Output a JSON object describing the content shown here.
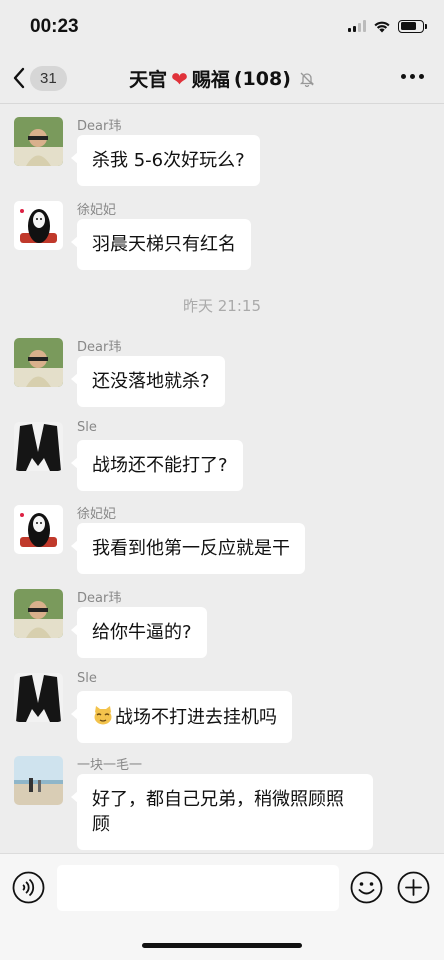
{
  "status_bar": {
    "time": "00:23",
    "battery_level": 0.75
  },
  "nav": {
    "back_count": "31",
    "title_left": "天官",
    "title_right": "赐福",
    "member_count": "(108)"
  },
  "messages": [
    {
      "sender": "Dear玮",
      "text": "杀我 5-6次好玩么?",
      "avatar": "person-avatar"
    },
    {
      "sender": "徐妃妃",
      "text": "羽晨天梯只有红名",
      "avatar": "no-face-avatar"
    },
    {
      "sender": "Dear玮",
      "text": "还没落地就杀?",
      "avatar": "person-avatar"
    },
    {
      "sender": "Sle",
      "text": "战场还不能打了?",
      "avatar": "dark-hair-avatar"
    },
    {
      "sender": "徐妃妃",
      "text": "我看到他第一反应就是干",
      "avatar": "no-face-avatar"
    },
    {
      "sender": "Dear玮",
      "text": "给你牛逼的?",
      "avatar": "person-avatar"
    },
    {
      "sender": "Sle",
      "text": "战场不打进去挂机吗",
      "avatar": "dark-hair-avatar"
    },
    {
      "sender": "一块一毛一",
      "text": "好了，都自己兄弟，稍微照顾照顾",
      "avatar": "beach-avatar"
    }
  ],
  "timestamp": "昨天 21:15",
  "input": {
    "placeholder": ""
  }
}
